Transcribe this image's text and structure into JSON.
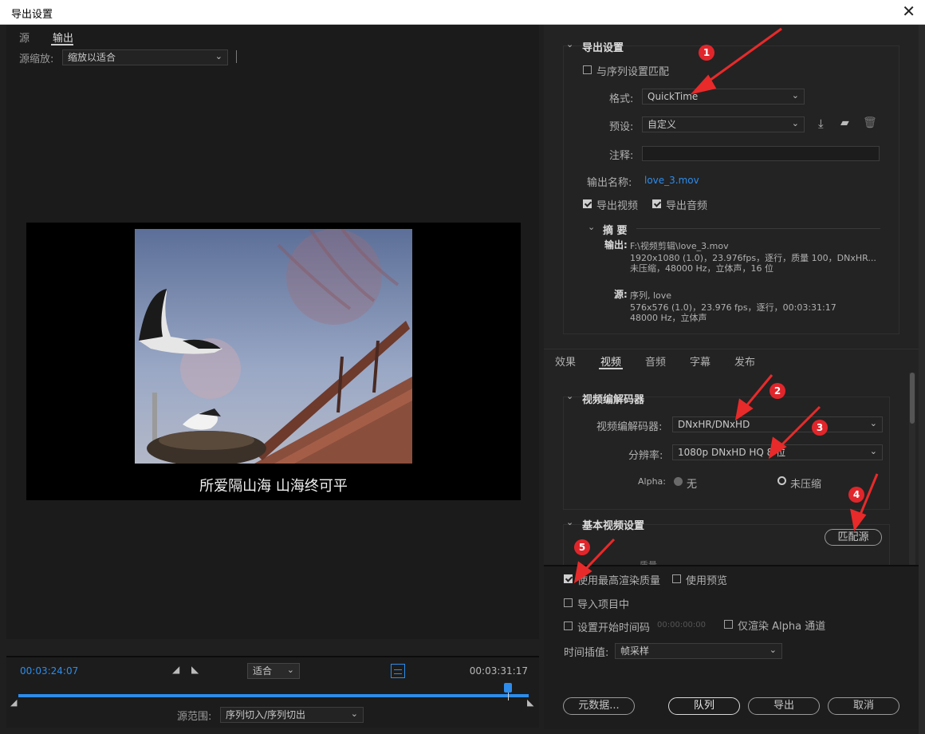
{
  "window": {
    "title": "导出设置",
    "close": "✕"
  },
  "left": {
    "tabs": [
      "源",
      "输出"
    ],
    "source_scale_label": "源缩放:",
    "source_scale_value": "缩放以适合",
    "subtitle": "所爱隔山海  山海终可平",
    "timecode_left": "00:03:24:07",
    "timecode_right": "00:03:31:17",
    "fit_value": "适合",
    "playhead_fraction": 0.96,
    "source_range_label": "源范围:",
    "source_range_value": "序列切入/序列切出"
  },
  "export": {
    "section_title": "导出设置",
    "match_sequence": "与序列设置匹配",
    "format_label": "格式:",
    "format_value": "QuickTime",
    "preset_label": "预设:",
    "preset_value": "自定义",
    "comment_label": "注释:",
    "output_name_label": "输出名称:",
    "output_name_value": "love_3.mov",
    "export_video": "导出视频",
    "export_audio": "导出音频",
    "summary_title": "摘 要",
    "summary_output_key": "输出:",
    "summary_output_line1": "F:\\视频剪辑\\love_3.mov",
    "summary_output_line2": "1920x1080 (1.0)，23.976fps，逐行，质量 100，DNxHR...",
    "summary_output_line3": "未压缩，48000 Hz，立体声，16 位",
    "summary_source_key": "源:",
    "summary_source_line1": "序列, love",
    "summary_source_line2": "576x576 (1.0)，23.976 fps，逐行，00:03:31:17",
    "summary_source_line3": "48000 Hz，立体声"
  },
  "settings_tabs": [
    "效果",
    "视频",
    "音频",
    "字幕",
    "发布"
  ],
  "video": {
    "codec_section": "视频编解码器",
    "codec_label": "视频编解码器:",
    "codec_value": "DNxHR/DNxHD",
    "resolution_label": "分辨率:",
    "resolution_value": "1080p DNxHD HQ 8 位",
    "alpha_label": "Alpha:",
    "alpha_none": "无",
    "alpha_uncompressed": "未压缩",
    "basic_section": "基本视频设置",
    "match_source": "匹配源",
    "quality_partial": "质量"
  },
  "bottom": {
    "max_render_quality": "使用最高渲染质量",
    "use_previews": "使用预览",
    "import_into_project": "导入项目中",
    "set_start_timecode": "设置开始时间码",
    "start_timecode_value": "00:00:00:00",
    "render_alpha_only": "仅渲染 Alpha 通道",
    "time_interp_label": "时间插值:",
    "time_interp_value": "帧采样",
    "metadata": "元数据...",
    "queue": "队列",
    "export": "导出",
    "cancel": "取消"
  },
  "badges": [
    "1",
    "2",
    "3",
    "4",
    "5"
  ],
  "colors": {
    "accent": "#2d8ceb",
    "badge": "#e0262b",
    "arrow": "#e82a2a"
  }
}
